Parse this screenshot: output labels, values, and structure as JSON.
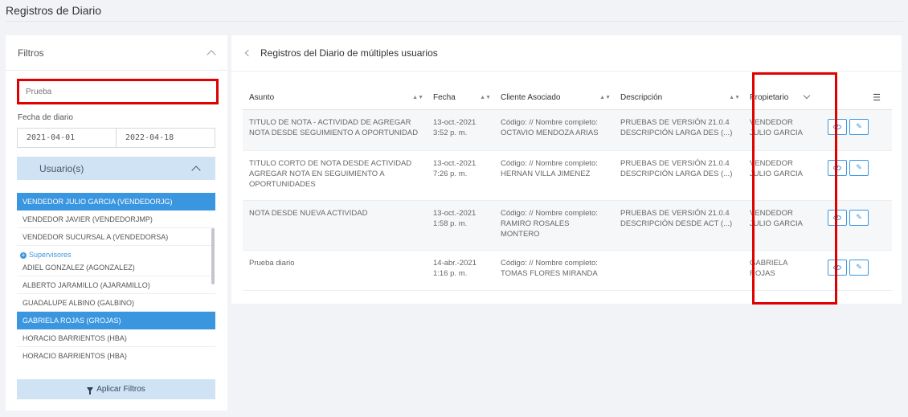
{
  "page": {
    "title": "Registros de Diario"
  },
  "filters": {
    "title": "Filtros",
    "search_value": "Prueba",
    "date_label": "Fecha de diario",
    "date_from": "2021-04-01",
    "date_to": "2022-04-18",
    "users_label": "Usuario(s)",
    "users": [
      {
        "label": "VENDEDOR JULIO GARCIA (VENDEDORJG)",
        "selected": true
      },
      {
        "label": "VENDEDOR JAVIER (VENDEDORJMP)",
        "selected": false
      },
      {
        "label": "VENDEDOR SUCURSAL A (VENDEDORSA)",
        "selected": false
      }
    ],
    "group_label": "Supervisores",
    "group_users": [
      {
        "label": "ADIEL GONZALEZ (AGONZALEZ)",
        "selected": false
      },
      {
        "label": "ALBERTO JARAMILLO (AJARAMILLO)",
        "selected": false
      },
      {
        "label": "GUADALUPE ALBINO (GALBINO)",
        "selected": false
      },
      {
        "label": "GABRIELA ROJAS (GROJAS)",
        "selected": true
      },
      {
        "label": "HORACIO BARRIENTOS (HBA)",
        "selected": false
      },
      {
        "label": "HORACIO BARRIENTOS (HBA)",
        "selected": false
      }
    ],
    "apply_label": "Aplicar Filtros"
  },
  "records": {
    "title": "Registros del Diario de múltiples usuarios",
    "columns": [
      "Asunto",
      "Fecha",
      "Cliente Asociado",
      "Descripción",
      "Propietario"
    ],
    "rows": [
      {
        "asunto": "TITULO DE NOTA - ACTIVIDAD DE AGREGAR NOTA DESDE SEGUIMIENTO A OPORTUNIDAD",
        "fecha": "13-oct.-2021 3:52 p. m.",
        "cliente": "Código: // Nombre completo: OCTAVIO MENDOZA ARIAS",
        "descripcion": "PRUEBAS DE VERSIÓN 21.0.4 DESCRIPCIÓN LARGA DES (...)",
        "propietario": "VENDEDOR JULIO GARCIA"
      },
      {
        "asunto": "TITULO CORTO DE NOTA DESDE ACTIVIDAD AGREGAR NOTA EN SEGUIMIENTO A OPORTUNIDADES",
        "fecha": "13-oct.-2021 7:26 p. m.",
        "cliente": "Código: // Nombre completo: HERNAN VILLA JIMENEZ",
        "descripcion": "PRUEBAS DE VERSIÓN 21.0.4 DESCRIPCIÓN LARGA DES (...)",
        "propietario": "VENDEDOR JULIO GARCIA"
      },
      {
        "asunto": "NOTA DESDE NUEVA ACTIVIDAD",
        "fecha": "13-oct.-2021 1:58 p. m.",
        "cliente": "Código: // Nombre completo: RAMIRO ROSALES MONTERO",
        "descripcion": "PRUEBAS DE VERSIÓN 21.0.4 DESCRIPCIÓN DESDE ACT (...)",
        "propietario": "VENDEDOR JULIO GARCIA"
      },
      {
        "asunto": "Prueba diario",
        "fecha": "14-abr.-2021 1:16 p. m.",
        "cliente": "Código: // Nombre completo: TOMAS FLORES MIRANDA",
        "descripcion": "",
        "propietario": "GABRIELA ROJAS"
      }
    ]
  },
  "colors": {
    "accent": "#3b96e0",
    "highlight": "#e00000",
    "toggle_bg": "#cfe3f5"
  }
}
